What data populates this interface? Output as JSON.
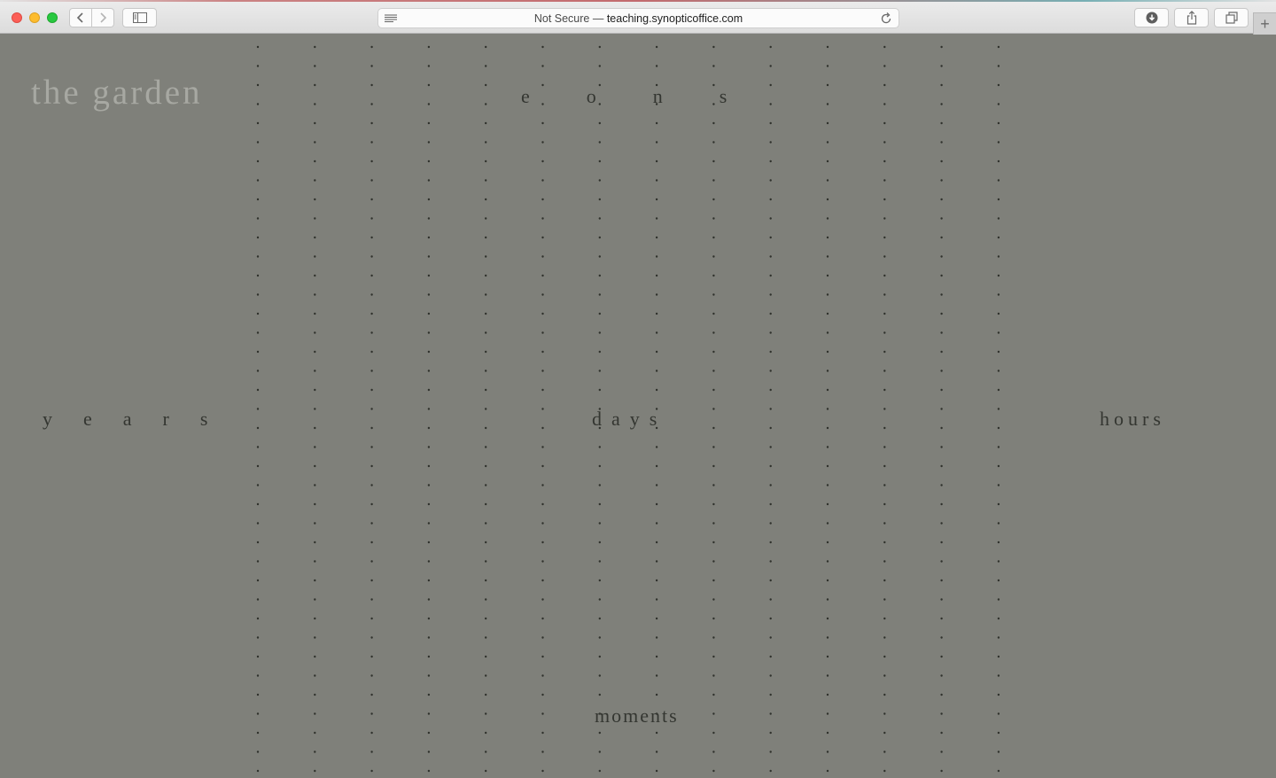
{
  "browser": {
    "url_prefix": "Not Secure — ",
    "url_domain": "teaching.synopticoffice.com",
    "icons": [
      "back-icon",
      "forward-icon",
      "sidebar-icon",
      "reader-icon",
      "reload-icon",
      "download-icon",
      "share-icon",
      "tabs-icon",
      "new-tab-icon"
    ]
  },
  "page": {
    "title": "the garden",
    "words": {
      "eons": "eons",
      "years": "years",
      "days": "days",
      "hours": "hours",
      "moments": "moments"
    },
    "colors": {
      "background": "#7f807a",
      "text": "#343631",
      "title": "#a7a8a2",
      "dots": "#2f312c"
    }
  }
}
